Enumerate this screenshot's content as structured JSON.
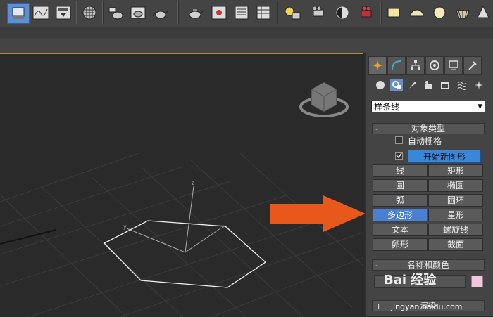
{
  "toolbar": {
    "icons": [
      "select-object-icon",
      "curve-editor-icon",
      "render-setup-icon",
      "material-editor-icon",
      "render-frame-icon",
      "teapot-render-icon",
      "teapot-icon",
      "quick-render-icon",
      "teapot-active-icon",
      "environment-icon",
      "render-window-icon",
      "schematic-icon",
      "light-list-icon",
      "camera-icon",
      "half-sphere-icon",
      "film-camera-icon",
      "box-icon",
      "dome-icon",
      "sphere-icon",
      "basket-icon",
      "cone-icon"
    ]
  },
  "viewport": {
    "axis_z": "z",
    "axis_x": "x",
    "axis_y": "y"
  },
  "command_panel": {
    "tabs": [
      "create-tab",
      "modify-tab",
      "hierarchy-tab",
      "motion-tab",
      "display-tab",
      "utilities-tab"
    ],
    "subcategories": [
      "geometry-icon",
      "shapes-icon",
      "lights-icon",
      "cameras-icon",
      "helpers-icon",
      "spacewarps-icon",
      "systems-icon"
    ],
    "dropdown_value": "样条线",
    "object_type": {
      "header": "对象类型",
      "collapse_symbol": "-",
      "auto_grid_label": "自动栅格",
      "start_new_shape_label": "开始新图形",
      "buttons": [
        [
          "线",
          "矩形"
        ],
        [
          "圆",
          "椭圆"
        ],
        [
          "弧",
          "圆环"
        ],
        [
          "多边形",
          "星形"
        ],
        [
          "文本",
          "螺旋线"
        ],
        [
          "卵形",
          "截面"
        ]
      ],
      "selected_button": "多边形"
    },
    "name_color": {
      "header": "名称和颜色",
      "collapse_symbol": "-",
      "name_value": "",
      "swatch_color": "#f3c6e0"
    },
    "rendering": {
      "header": "渲染",
      "collapse_symbol": "+"
    }
  },
  "annotation": {
    "arrow_color": "#e8581c"
  },
  "watermark": {
    "logo_text": "Bai 经验",
    "url": "jingyan.baidu.com"
  }
}
